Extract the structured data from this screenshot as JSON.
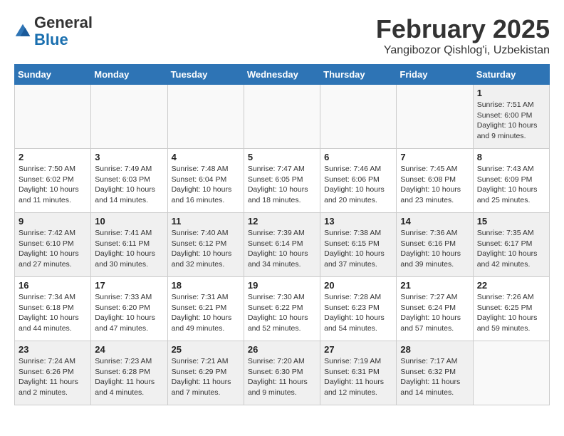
{
  "header": {
    "logo_general": "General",
    "logo_blue": "Blue",
    "month_title": "February 2025",
    "subtitle": "Yangibozor Qishlog'i, Uzbekistan"
  },
  "days_of_week": [
    "Sunday",
    "Monday",
    "Tuesday",
    "Wednesday",
    "Thursday",
    "Friday",
    "Saturday"
  ],
  "weeks": [
    [
      {
        "day": "",
        "info": ""
      },
      {
        "day": "",
        "info": ""
      },
      {
        "day": "",
        "info": ""
      },
      {
        "day": "",
        "info": ""
      },
      {
        "day": "",
        "info": ""
      },
      {
        "day": "",
        "info": ""
      },
      {
        "day": "1",
        "info": "Sunrise: 7:51 AM\nSunset: 6:00 PM\nDaylight: 10 hours\nand 9 minutes."
      }
    ],
    [
      {
        "day": "2",
        "info": "Sunrise: 7:50 AM\nSunset: 6:02 PM\nDaylight: 10 hours\nand 11 minutes."
      },
      {
        "day": "3",
        "info": "Sunrise: 7:49 AM\nSunset: 6:03 PM\nDaylight: 10 hours\nand 14 minutes."
      },
      {
        "day": "4",
        "info": "Sunrise: 7:48 AM\nSunset: 6:04 PM\nDaylight: 10 hours\nand 16 minutes."
      },
      {
        "day": "5",
        "info": "Sunrise: 7:47 AM\nSunset: 6:05 PM\nDaylight: 10 hours\nand 18 minutes."
      },
      {
        "day": "6",
        "info": "Sunrise: 7:46 AM\nSunset: 6:06 PM\nDaylight: 10 hours\nand 20 minutes."
      },
      {
        "day": "7",
        "info": "Sunrise: 7:45 AM\nSunset: 6:08 PM\nDaylight: 10 hours\nand 23 minutes."
      },
      {
        "day": "8",
        "info": "Sunrise: 7:43 AM\nSunset: 6:09 PM\nDaylight: 10 hours\nand 25 minutes."
      }
    ],
    [
      {
        "day": "9",
        "info": "Sunrise: 7:42 AM\nSunset: 6:10 PM\nDaylight: 10 hours\nand 27 minutes."
      },
      {
        "day": "10",
        "info": "Sunrise: 7:41 AM\nSunset: 6:11 PM\nDaylight: 10 hours\nand 30 minutes."
      },
      {
        "day": "11",
        "info": "Sunrise: 7:40 AM\nSunset: 6:12 PM\nDaylight: 10 hours\nand 32 minutes."
      },
      {
        "day": "12",
        "info": "Sunrise: 7:39 AM\nSunset: 6:14 PM\nDaylight: 10 hours\nand 34 minutes."
      },
      {
        "day": "13",
        "info": "Sunrise: 7:38 AM\nSunset: 6:15 PM\nDaylight: 10 hours\nand 37 minutes."
      },
      {
        "day": "14",
        "info": "Sunrise: 7:36 AM\nSunset: 6:16 PM\nDaylight: 10 hours\nand 39 minutes."
      },
      {
        "day": "15",
        "info": "Sunrise: 7:35 AM\nSunset: 6:17 PM\nDaylight: 10 hours\nand 42 minutes."
      }
    ],
    [
      {
        "day": "16",
        "info": "Sunrise: 7:34 AM\nSunset: 6:18 PM\nDaylight: 10 hours\nand 44 minutes."
      },
      {
        "day": "17",
        "info": "Sunrise: 7:33 AM\nSunset: 6:20 PM\nDaylight: 10 hours\nand 47 minutes."
      },
      {
        "day": "18",
        "info": "Sunrise: 7:31 AM\nSunset: 6:21 PM\nDaylight: 10 hours\nand 49 minutes."
      },
      {
        "day": "19",
        "info": "Sunrise: 7:30 AM\nSunset: 6:22 PM\nDaylight: 10 hours\nand 52 minutes."
      },
      {
        "day": "20",
        "info": "Sunrise: 7:28 AM\nSunset: 6:23 PM\nDaylight: 10 hours\nand 54 minutes."
      },
      {
        "day": "21",
        "info": "Sunrise: 7:27 AM\nSunset: 6:24 PM\nDaylight: 10 hours\nand 57 minutes."
      },
      {
        "day": "22",
        "info": "Sunrise: 7:26 AM\nSunset: 6:25 PM\nDaylight: 10 hours\nand 59 minutes."
      }
    ],
    [
      {
        "day": "23",
        "info": "Sunrise: 7:24 AM\nSunset: 6:26 PM\nDaylight: 11 hours\nand 2 minutes."
      },
      {
        "day": "24",
        "info": "Sunrise: 7:23 AM\nSunset: 6:28 PM\nDaylight: 11 hours\nand 4 minutes."
      },
      {
        "day": "25",
        "info": "Sunrise: 7:21 AM\nSunset: 6:29 PM\nDaylight: 11 hours\nand 7 minutes."
      },
      {
        "day": "26",
        "info": "Sunrise: 7:20 AM\nSunset: 6:30 PM\nDaylight: 11 hours\nand 9 minutes."
      },
      {
        "day": "27",
        "info": "Sunrise: 7:19 AM\nSunset: 6:31 PM\nDaylight: 11 hours\nand 12 minutes."
      },
      {
        "day": "28",
        "info": "Sunrise: 7:17 AM\nSunset: 6:32 PM\nDaylight: 11 hours\nand 14 minutes."
      },
      {
        "day": "",
        "info": ""
      }
    ]
  ]
}
